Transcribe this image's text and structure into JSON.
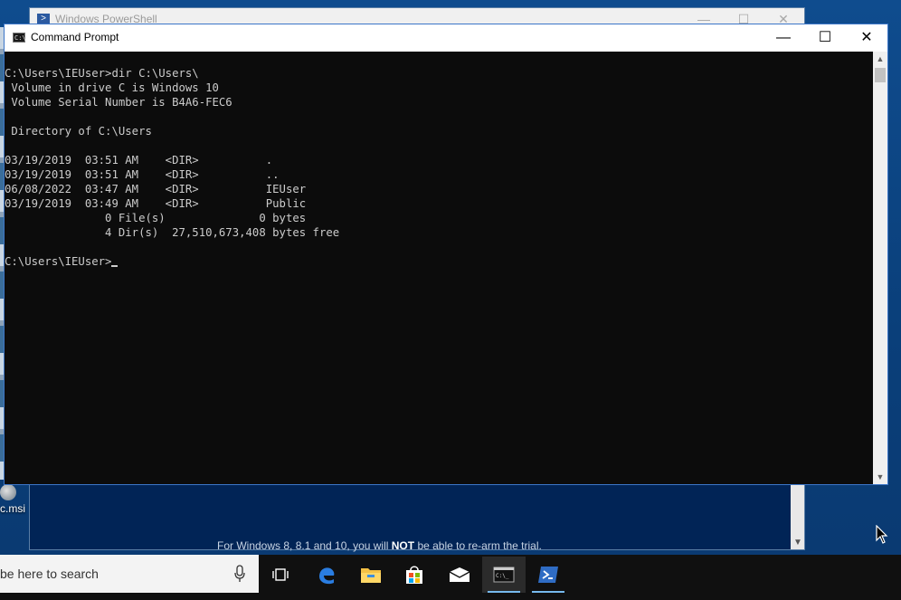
{
  "powershell": {
    "title": "Windows PowerShell",
    "bottom_text_before": "For Windows 8, 8.1 and 10, you will ",
    "bottom_text_bold": "NOT",
    "bottom_text_after": " be able to re-arm the trial."
  },
  "cmd": {
    "title": "Command Prompt",
    "lines": [
      "",
      "C:\\Users\\IEUser>dir C:\\Users\\",
      " Volume in drive C is Windows 10",
      " Volume Serial Number is B4A6-FEC6",
      "",
      " Directory of C:\\Users",
      "",
      "03/19/2019  03:51 AM    <DIR>          .",
      "03/19/2019  03:51 AM    <DIR>          ..",
      "06/08/2022  03:47 AM    <DIR>          IEUser",
      "03/19/2019  03:49 AM    <DIR>          Public",
      "               0 File(s)              0 bytes",
      "               4 Dir(s)  27,510,673,408 bytes free",
      ""
    ],
    "prompt": "C:\\Users\\IEUser>"
  },
  "desktop": {
    "icon_label": "c.msi"
  },
  "taskbar": {
    "search_placeholder": "be here to search",
    "apps": [
      "task-view",
      "edge",
      "file-explorer",
      "store",
      "mail",
      "command-prompt",
      "powershell"
    ],
    "accent": "#76b9ed"
  },
  "colors": {
    "console_bg": "#0c0c0c",
    "console_fg": "#cccccc",
    "desktop_bg": "#0f4c8e",
    "taskbar_bg": "#101010"
  }
}
